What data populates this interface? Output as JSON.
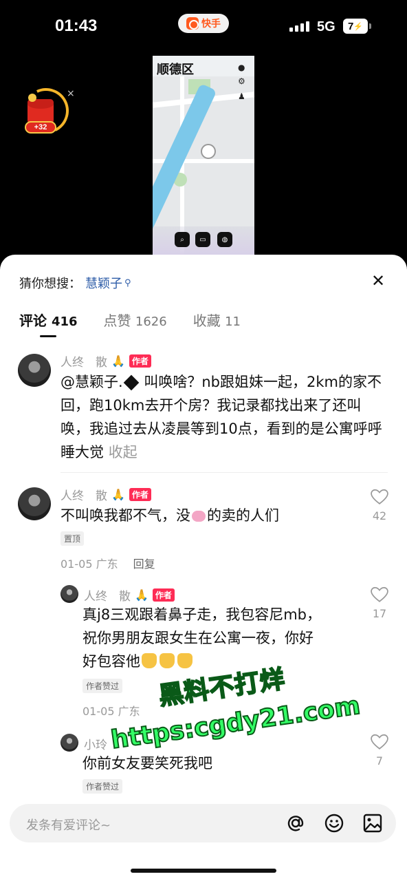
{
  "status_bar": {
    "time": "01:43",
    "app_name": "快手",
    "network": "5G",
    "battery": "7"
  },
  "reward": {
    "points": "+32",
    "close": "×"
  },
  "video": {
    "title": "顺德区"
  },
  "sheet": {
    "guess_label": "猜你想搜：",
    "guess_term": "慧颖子",
    "close": "✕",
    "tabs": [
      {
        "label": "评论",
        "count": "416"
      },
      {
        "label": "点赞",
        "count": "1626"
      },
      {
        "label": "收藏",
        "count": "11"
      }
    ]
  },
  "comments": [
    {
      "user": "人终　散",
      "author_tag": "作者",
      "text_a": "@慧颖子.",
      "text_b": " 叫唤啥？nb跟姐妹一起，2km的家不回，跑10km去开个房？我记录都找出来了还叫唤，我追过去从凌晨等到10点，看到的是公寓呼呼睡大觉 ",
      "collapse": "收起"
    },
    {
      "user": "人终　散",
      "author_tag": "作者",
      "text_a": "不叫唤我都不气，没",
      "text_b": "的卖的人们",
      "pinned": "置顶",
      "date": "01-05 广东",
      "reply": "回复",
      "likes": "42"
    }
  ],
  "replies": [
    {
      "user": "人终　散",
      "author_tag": "作者",
      "text": "真j8三观跟着鼻子走，我包容尼mb，祝你男朋友跟女生在公寓一夜，你好好包容他",
      "badge": "作者赞过",
      "date": "01-05 广东",
      "likes": "17"
    },
    {
      "user": "小玲",
      "text": "你前女友要笑死我吧",
      "badge": "作者赞过",
      "likes": "7"
    }
  ],
  "watermark": {
    "line1": "黑料不打烊",
    "line2": "https:cgdy21.com"
  },
  "input": {
    "placeholder": "发条有爱评论~"
  },
  "colors": {
    "author_tag": "#fe2c55",
    "link": "#2e5da8",
    "watermark": "#33ff66"
  }
}
